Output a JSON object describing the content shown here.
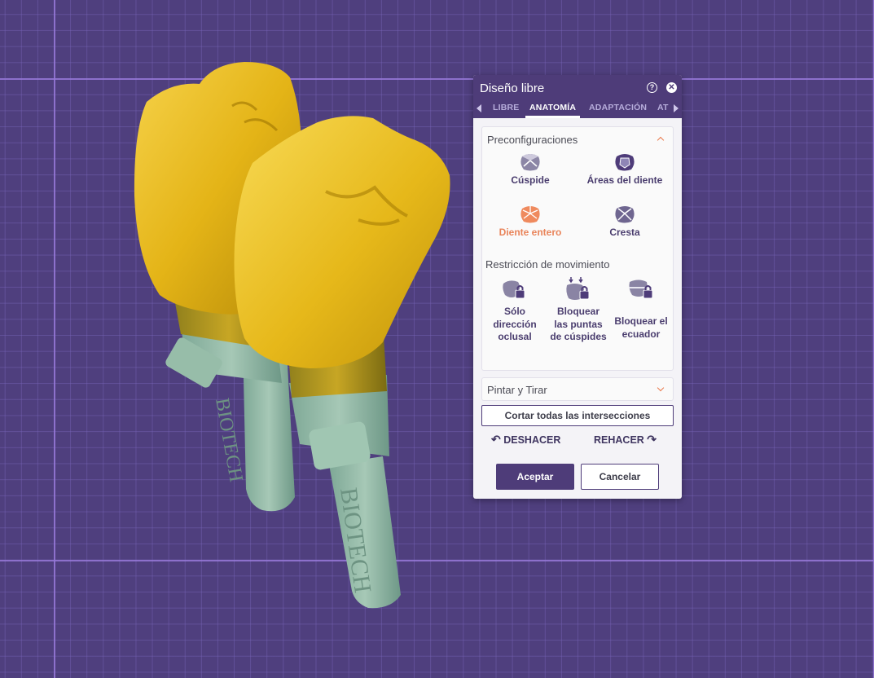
{
  "panel": {
    "title": "Diseño libre",
    "tabs": [
      "LIBRE",
      "ANATOMÍA",
      "ADAPTACIÓN",
      "AT"
    ],
    "active_tab": "ANATOMÍA",
    "presets": {
      "title": "Preconfiguraciones",
      "items": [
        {
          "label": "Cúspide",
          "icon": "cusp-icon"
        },
        {
          "label": "Áreas del diente",
          "icon": "tooth-areas-icon"
        },
        {
          "label": "Diente entero",
          "icon": "whole-tooth-icon",
          "active": true
        },
        {
          "label": "Cresta",
          "icon": "ridge-icon"
        }
      ]
    },
    "restriction": {
      "title": "Restricción de movimiento",
      "items": [
        {
          "label": "Sólo dirección oclusal",
          "icon": "occlusal-lock-icon"
        },
        {
          "label": "Bloquear las puntas de cúspides",
          "icon": "cusp-tips-lock-icon"
        },
        {
          "label": "Bloquear el ecuador",
          "icon": "equator-lock-icon"
        }
      ]
    },
    "paint": {
      "title": "Pintar y Tirar"
    },
    "cut_all": "Cortar todas las intersecciones",
    "undo": "DESHACER",
    "redo": "REHACER",
    "accept": "Aceptar",
    "cancel": "Cancelar"
  },
  "viewport": {
    "implant_engraving": "BIOTECH"
  },
  "colors": {
    "accent": "#4e3c79",
    "highlight": "#e9845a",
    "crown": "#e5b416",
    "abutment": "#8fb5a0",
    "background": "#4f3f7e"
  }
}
